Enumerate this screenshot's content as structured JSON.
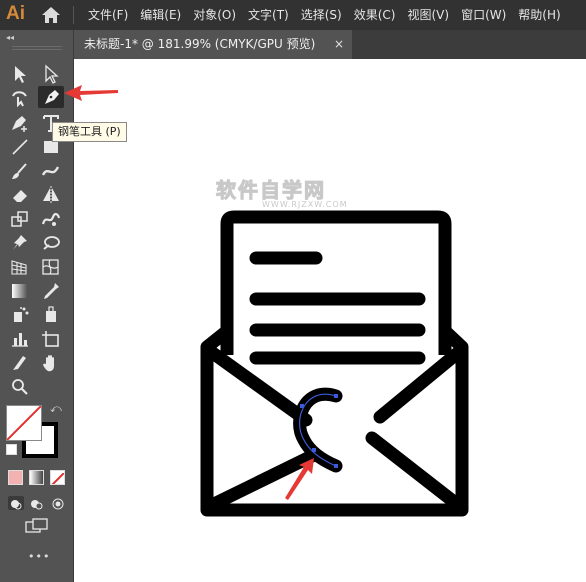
{
  "app": {
    "logo": "Ai",
    "home_icon": "home-icon"
  },
  "menu": [
    "文件(F)",
    "编辑(E)",
    "对象(O)",
    "文字(T)",
    "选择(S)",
    "效果(C)",
    "视图(V)",
    "窗口(W)",
    "帮助(H)"
  ],
  "toolbar": {
    "collapse": "◂◂",
    "tools": [
      "selection-tool",
      "direct-selection-tool",
      "curvature-tool",
      "pen-tool",
      "add-anchor-tool",
      "type-tool",
      "line-tool",
      "rectangle-tool",
      "paintbrush-tool",
      "shaper-tool",
      "eraser-tool",
      "reflect-tool",
      "scale-tool",
      "puppet-warp-tool",
      "pin-tool",
      "gradient-mesh-tool",
      "perspective-grid-tool",
      "mesh-tool",
      "gradient-tool",
      "eyedropper-tool",
      "symbol-sprayer-tool",
      "live-paint-tool",
      "column-graph-tool",
      "artboard-tool",
      "slice-tool",
      "hand-tool",
      "zoom-tool"
    ],
    "active_tool": "pen-tool",
    "more": "•••"
  },
  "document_tab": {
    "title": "未标题-1* @ 181.99% (CMYK/GPU 预览)",
    "close": "×"
  },
  "tooltip": {
    "text": "钢笔工具 (P)"
  },
  "watermark": {
    "title": "软件自学网",
    "url": "WWW.RJZXW.COM"
  },
  "colors": {
    "accent_arrow": "#e53935",
    "path_selection": "#3b5bdb",
    "stroke": "#000000",
    "menubar": "#323232",
    "panel": "#535353"
  }
}
